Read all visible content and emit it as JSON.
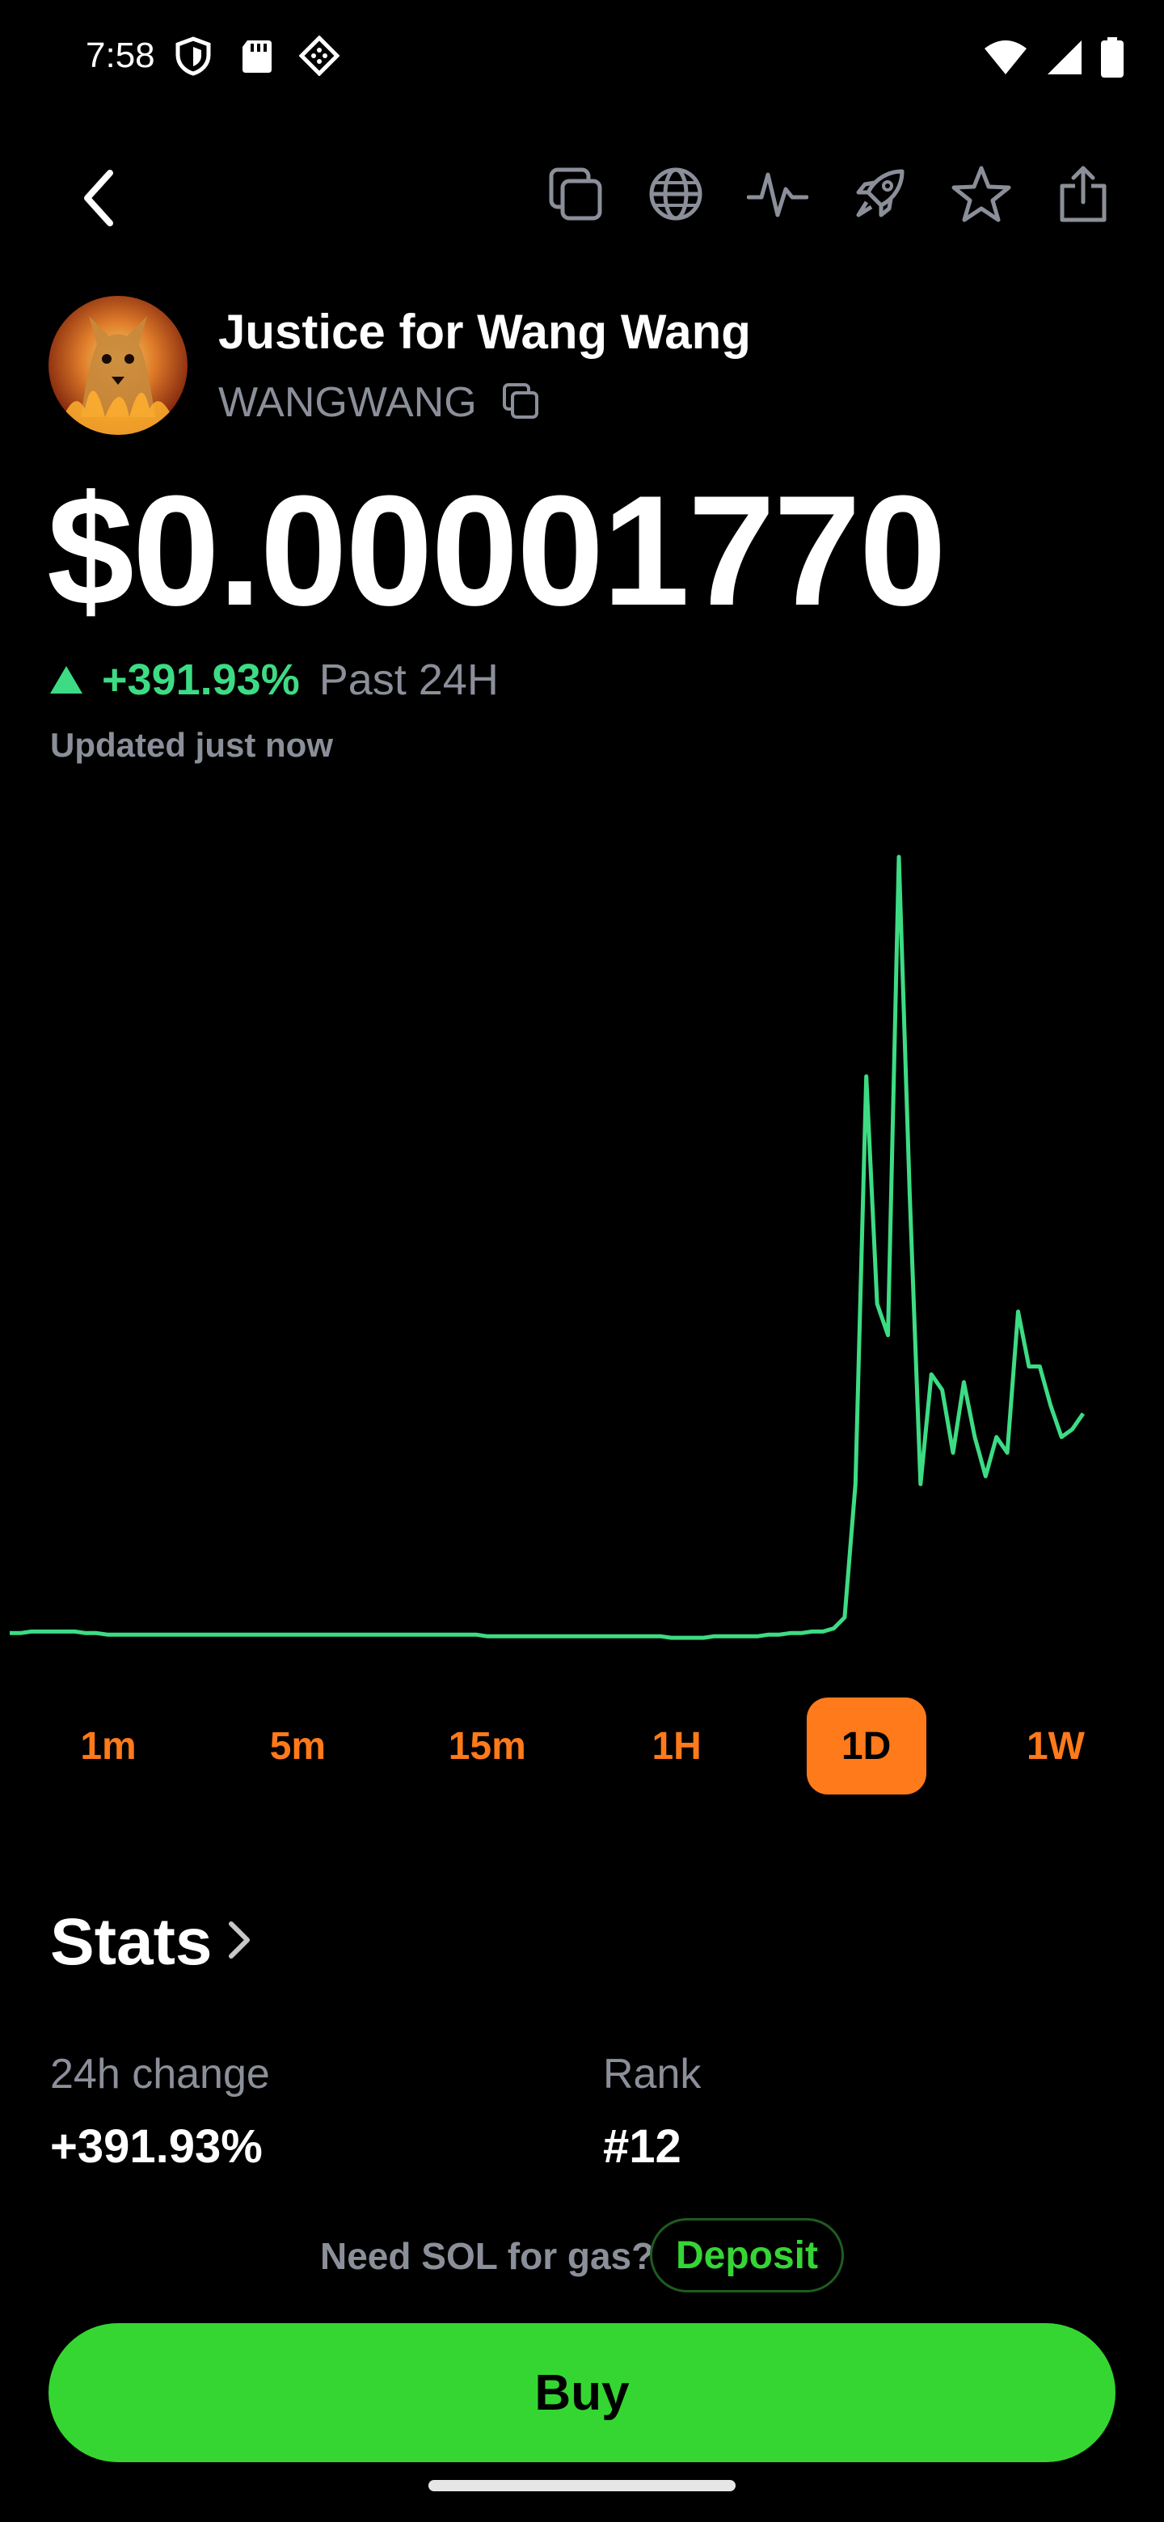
{
  "status_bar": {
    "time": "7:58",
    "left_icons": [
      "shield-icon",
      "sd-card-icon",
      "diamond-icon"
    ],
    "right_icons": [
      "wifi-icon",
      "signal-icon",
      "battery-icon"
    ]
  },
  "toolbar": {
    "icons": [
      "back-icon",
      "copy-pages-icon",
      "globe-icon",
      "pulse-icon",
      "rocket-icon",
      "star-icon",
      "share-icon"
    ]
  },
  "token": {
    "name": "Justice for Wang Wang",
    "symbol": "WANGWANG",
    "price": "$0.00001770",
    "change": "+391.93%",
    "change_period": "Past 24H",
    "updated": "Updated just now"
  },
  "chart_data": {
    "type": "line",
    "title": "",
    "xlabel": "",
    "ylabel": "",
    "grid": false,
    "legend": "none",
    "series_color": "#3ddc84",
    "x": [
      0,
      1,
      2,
      3,
      4,
      5,
      6,
      7,
      8,
      9,
      10,
      11,
      12,
      13,
      14,
      15,
      16,
      17,
      18,
      19,
      20,
      21,
      22,
      23,
      24,
      25,
      26,
      27,
      28,
      29,
      30,
      31,
      32,
      33,
      34,
      35,
      36,
      37,
      38,
      39,
      40,
      41,
      42,
      43,
      44,
      45,
      46,
      47,
      48,
      49,
      50,
      51,
      52,
      53,
      54,
      55,
      56,
      57,
      58,
      59,
      60,
      61,
      62,
      63,
      64,
      65,
      66,
      67,
      68,
      69,
      70,
      71,
      72,
      73,
      74,
      75,
      76,
      77,
      78,
      79,
      80,
      81,
      82,
      83,
      84,
      85,
      86,
      87,
      88,
      89,
      90,
      91,
      92,
      93,
      94,
      95,
      96,
      97,
      98,
      99
    ],
    "values": [
      0.05,
      0.05,
      0.06,
      0.06,
      0.06,
      0.06,
      0.06,
      0.05,
      0.05,
      0.04,
      0.04,
      0.04,
      0.04,
      0.04,
      0.04,
      0.04,
      0.04,
      0.04,
      0.04,
      0.04,
      0.04,
      0.04,
      0.04,
      0.04,
      0.04,
      0.04,
      0.04,
      0.04,
      0.04,
      0.04,
      0.04,
      0.04,
      0.04,
      0.04,
      0.04,
      0.04,
      0.04,
      0.04,
      0.04,
      0.04,
      0.04,
      0.04,
      0.04,
      0.04,
      0.03,
      0.03,
      0.03,
      0.03,
      0.03,
      0.03,
      0.03,
      0.03,
      0.03,
      0.03,
      0.03,
      0.03,
      0.03,
      0.03,
      0.03,
      0.03,
      0.03,
      0.02,
      0.02,
      0.02,
      0.02,
      0.03,
      0.03,
      0.03,
      0.03,
      0.03,
      0.04,
      0.04,
      0.05,
      0.05,
      0.06,
      0.06,
      0.08,
      0.15,
      1.0,
      3.6,
      2.15,
      1.95,
      5.0,
      2.85,
      1.0,
      1.7,
      1.6,
      1.2,
      1.65,
      1.3,
      1.05,
      1.3,
      1.2,
      2.1,
      1.75,
      1.75,
      1.5,
      1.3,
      1.35,
      1.45
    ]
  },
  "ranges": {
    "items": [
      "1m",
      "5m",
      "15m",
      "1H",
      "1D",
      "1W"
    ],
    "active": "1D",
    "accent": "#ff7a1a"
  },
  "stats": {
    "title": "Stats",
    "items": [
      {
        "label": "24h change",
        "value": "+391.93%"
      },
      {
        "label": "Rank",
        "value": "#12"
      }
    ]
  },
  "gas": {
    "prompt": "Need SOL for gas?",
    "deposit_label": "Deposit"
  },
  "buy": {
    "label": "Buy",
    "color": "#35d632"
  }
}
